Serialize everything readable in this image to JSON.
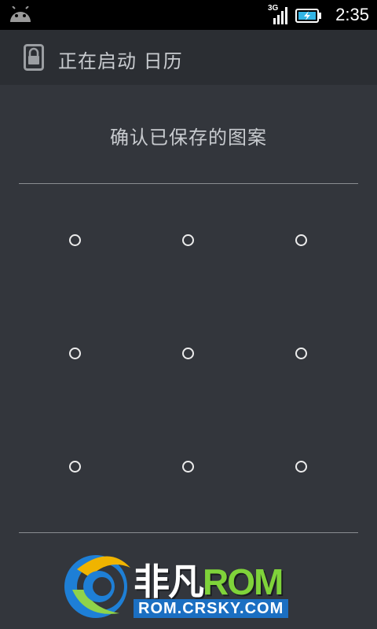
{
  "status_bar": {
    "network_type": "3G",
    "time": "2:35",
    "icons": [
      "android-icon",
      "signal-icon",
      "battery-charging-icon"
    ]
  },
  "header": {
    "title": "正在启动 日历",
    "icon": "lock-icon"
  },
  "prompt": "确认已保存的图案",
  "pattern": {
    "rows": 3,
    "cols": 3
  },
  "watermark": {
    "brand_main": "非凡",
    "brand_accent": "ROM",
    "url": "ROM.CRSKY.COM"
  },
  "colors": {
    "background": "#33363c",
    "header": "#2b2e33",
    "status_bar": "#000000",
    "text": "#c8cbcf",
    "dot": "#ececec",
    "battery_accent": "#33b5e5"
  }
}
